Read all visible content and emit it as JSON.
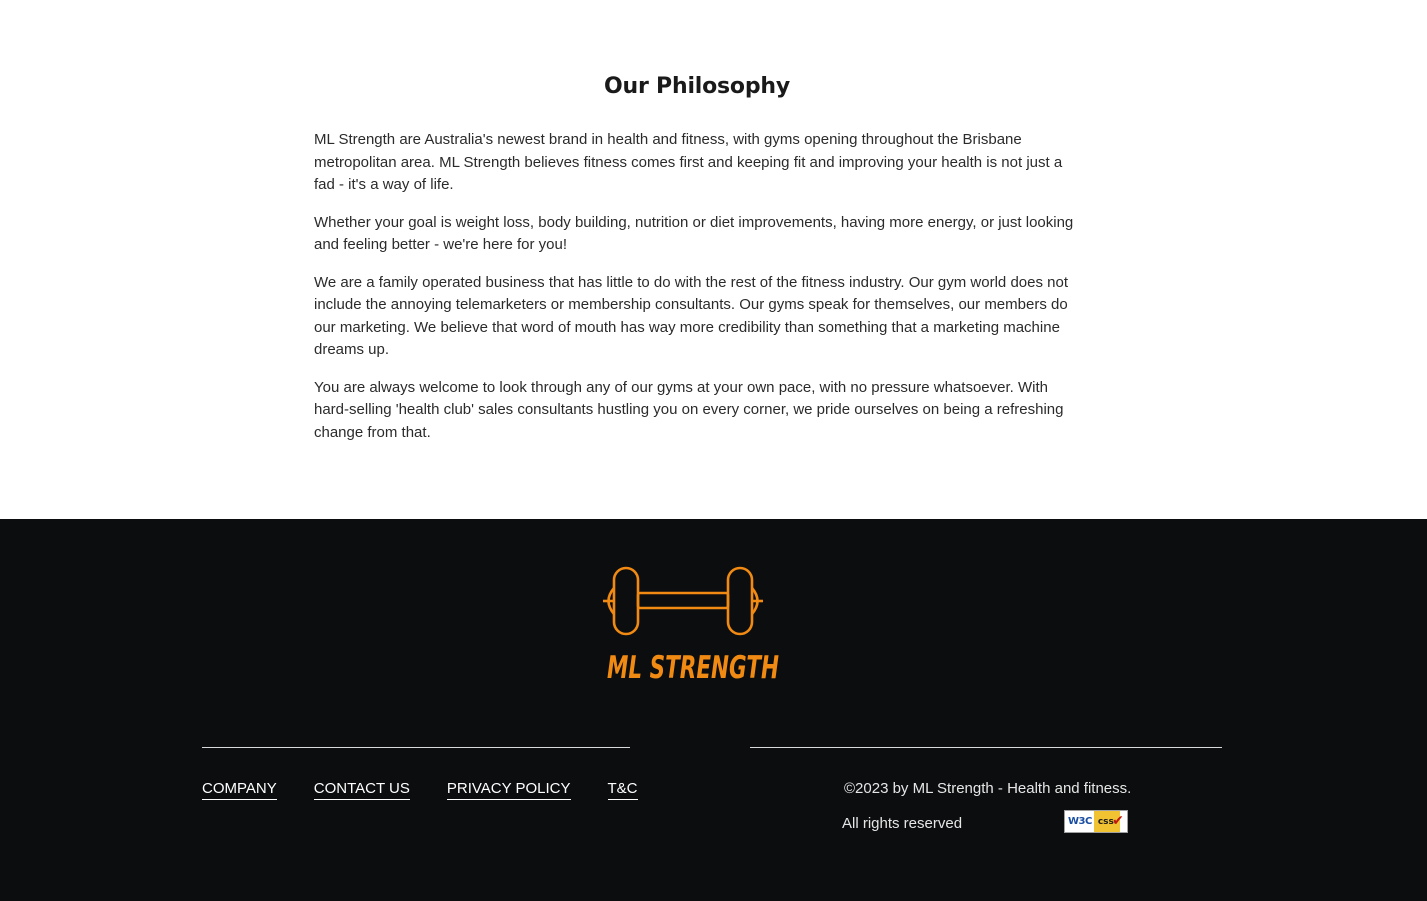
{
  "philosophy": {
    "title": "Our Philosophy",
    "paragraphs": [
      "ML Strength are Australia's newest brand in health and fitness, with gyms opening throughout the Brisbane metropolitan area. ML Strength believes fitness comes first and keeping fit and improving your health is not just a fad - it's a way of life.",
      "Whether your goal is weight loss, body building, nutrition or diet improvements, having more energy, or just looking and feeling better - we're here for you!",
      "We are a family operated business that has little to do with the rest of the fitness industry. Our gym world does not include the annoying telemarketers or membership consultants. Our gyms speak for themselves, our members do our marketing. We believe that word of mouth has way more credibility than something that a marketing machine dreams up.",
      "You are always welcome to look through any of our gyms at your own pace, with no pressure whatsoever. With hard-selling 'health club' sales consultants hustling you on every corner, we pride ourselves on being a refreshing change from that."
    ]
  },
  "footer": {
    "logo_text": "ML STRENGTH",
    "logo_icon": "dumbbell-icon",
    "brand_color": "#f08a12",
    "background_color": "#0c0d0f",
    "nav": [
      {
        "label": "COMPANY"
      },
      {
        "label": "CONTACT US"
      },
      {
        "label": "PRIVACY POLICY"
      },
      {
        "label": "T&C"
      }
    ],
    "copyright": "©2023 by ML Strength - Health and fitness.",
    "rights": "All rights reserved",
    "badge": {
      "w3c": "W3C",
      "css": "css"
    }
  }
}
